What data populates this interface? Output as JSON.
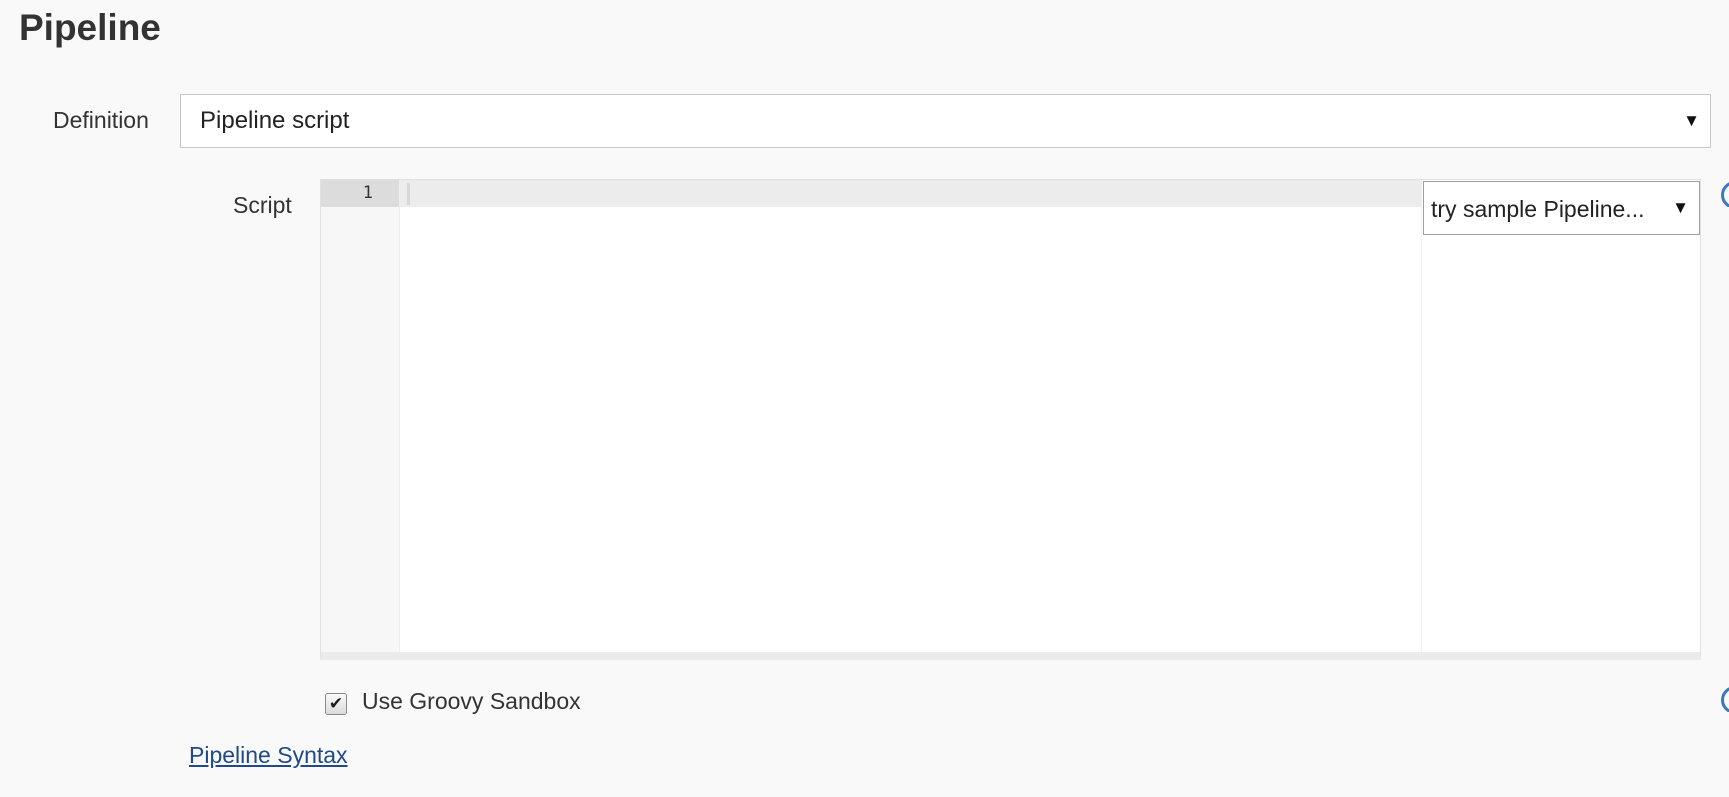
{
  "section": {
    "title": "Pipeline"
  },
  "definition": {
    "label": "Definition",
    "selected": "Pipeline script",
    "caret": "▼"
  },
  "script": {
    "label": "Script",
    "line_numbers": [
      "1"
    ],
    "sample_select": {
      "selected": "try sample Pipeline...",
      "caret": "▼"
    }
  },
  "sandbox": {
    "label": "Use Groovy Sandbox",
    "checked": true,
    "check_glyph": "✔"
  },
  "links": {
    "pipeline_syntax": "Pipeline Syntax"
  },
  "icons": {
    "help": "help-icon"
  },
  "colors": {
    "link": "#204a87",
    "help_icon": "#3b78c3"
  }
}
